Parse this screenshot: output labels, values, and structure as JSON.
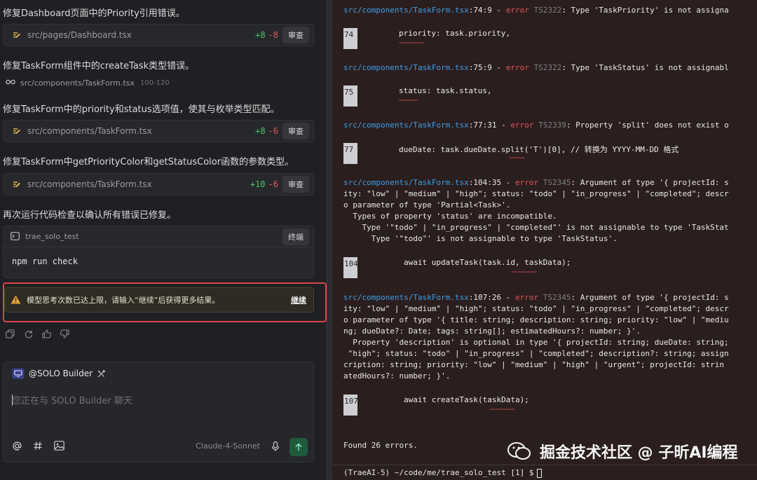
{
  "left": {
    "messages": [
      "修复Dashboard页面中的Priority引用错误。",
      "修复TaskForm组件中的createTask类型错误。",
      "修复TaskForm中的priority和status选项值，使其与枚举类型匹配。",
      "修复TaskForm中getPriorityColor和getStatusColor函数的参数类型。",
      "再次运行代码检查以确认所有错误已修复。"
    ],
    "file_cards": [
      {
        "path": "src/pages/Dashboard.tsx",
        "added": "+8",
        "removed": "-8",
        "button": "审查"
      },
      {
        "path": "src/components/TaskForm.tsx",
        "added": "+8",
        "removed": "-6",
        "button": "审查"
      },
      {
        "path": "src/components/TaskForm.tsx",
        "added": "+10",
        "removed": "-6",
        "button": "审查"
      }
    ],
    "file_ref": {
      "path": "src/components/TaskForm.tsx",
      "range": "100-120"
    },
    "terminal_card": {
      "name": "trae_solo_test",
      "button": "终端",
      "command": "npm run check"
    },
    "warning": {
      "text": "模型思考次数已达上限，请输入“继续”后获得更多结果。",
      "action": "继续"
    },
    "chat": {
      "agent": "@SOLO Builder",
      "placeholder": "您正在与 SOLO Builder 聊天",
      "model": "Claude-4-Sonnet"
    }
  },
  "terminal": {
    "blocks": [
      {
        "loc": "src/components/TaskForm.tsx",
        "pos": ":74:9",
        "code": "TS2322",
        "msg": ": Type 'TaskPriority' is not assigna",
        "extra": [],
        "lineno": "74",
        "src": "priority: task.priority,",
        "squig": "~~~~~~~~"
      },
      {
        "loc": "src/components/TaskForm.tsx",
        "pos": ":75:9",
        "code": "TS2322",
        "msg": ": Type 'TaskStatus' is not assignabl",
        "extra": [],
        "lineno": "75",
        "src": "status: task.status,",
        "squig": "~~~~~~"
      },
      {
        "loc": "src/components/TaskForm.tsx",
        "pos": ":77:31",
        "code": "TS2339",
        "msg": ": Property 'split' does not exist o",
        "extra": [],
        "lineno": "77",
        "src": "dueDate: task.dueDate.split('T')[0], // 转换为 YYYY-MM-DD 格式",
        "squig": "~~~~~"
      },
      {
        "loc": "src/components/TaskForm.tsx",
        "pos": ":104:35",
        "code": "TS2345",
        "msg": ": Argument of type '{ projectId: s",
        "extra": [
          "ity: \"low\" | \"medium\" | \"high\"; status: \"todo\" | \"in_progress\" | \"completed\"; descr",
          "o parameter of type 'Partial<Task>'.",
          "  Types of property 'status' are incompatible.",
          "    Type '\"todo\" | \"in_progress\" | \"completed\"' is not assignable to type 'TaskStat",
          "      Type '\"todo\"' is not assignable to type 'TaskStatus'."
        ],
        "lineno": "104",
        "src": "await updateTask(task.id, taskData);",
        "squig": "~~~~~~~~"
      },
      {
        "loc": "src/components/TaskForm.tsx",
        "pos": ":107:26",
        "code": "TS2345",
        "msg": ": Argument of type '{ projectId: s",
        "extra": [
          "ity: \"low\" | \"medium\" | \"high\"; status: \"todo\" | \"in_progress\" | \"completed\"; descr",
          "o parameter of type '{ title: string; description: string; priority: \"low\" | \"mediu",
          "ng; dueDate?: Date; tags: string[]; estimatedHours?: number; }'.",
          "  Property 'description' is optional in type '{ projectId: string; dueDate: string;",
          " \"high\"; status: \"todo\" | \"in_progress\" | \"completed\"; description?: string; assign",
          "cription: string; priority: \"low\" | \"medium\" | \"high\" | \"urgent\"; projectId: strin",
          "atedHours?: number; }'."
        ],
        "lineno": "107",
        "src": "await createTask(taskData);",
        "squig": "~~~~~~~~"
      }
    ],
    "error_word": "error",
    "dash": " - ",
    "summary": "Found 26 errors.",
    "prompt": "(TraeAI-5) ~/code/me/trae_solo_test [1] $"
  },
  "watermark": "掘金技术社区 @ 子昕AI编程"
}
